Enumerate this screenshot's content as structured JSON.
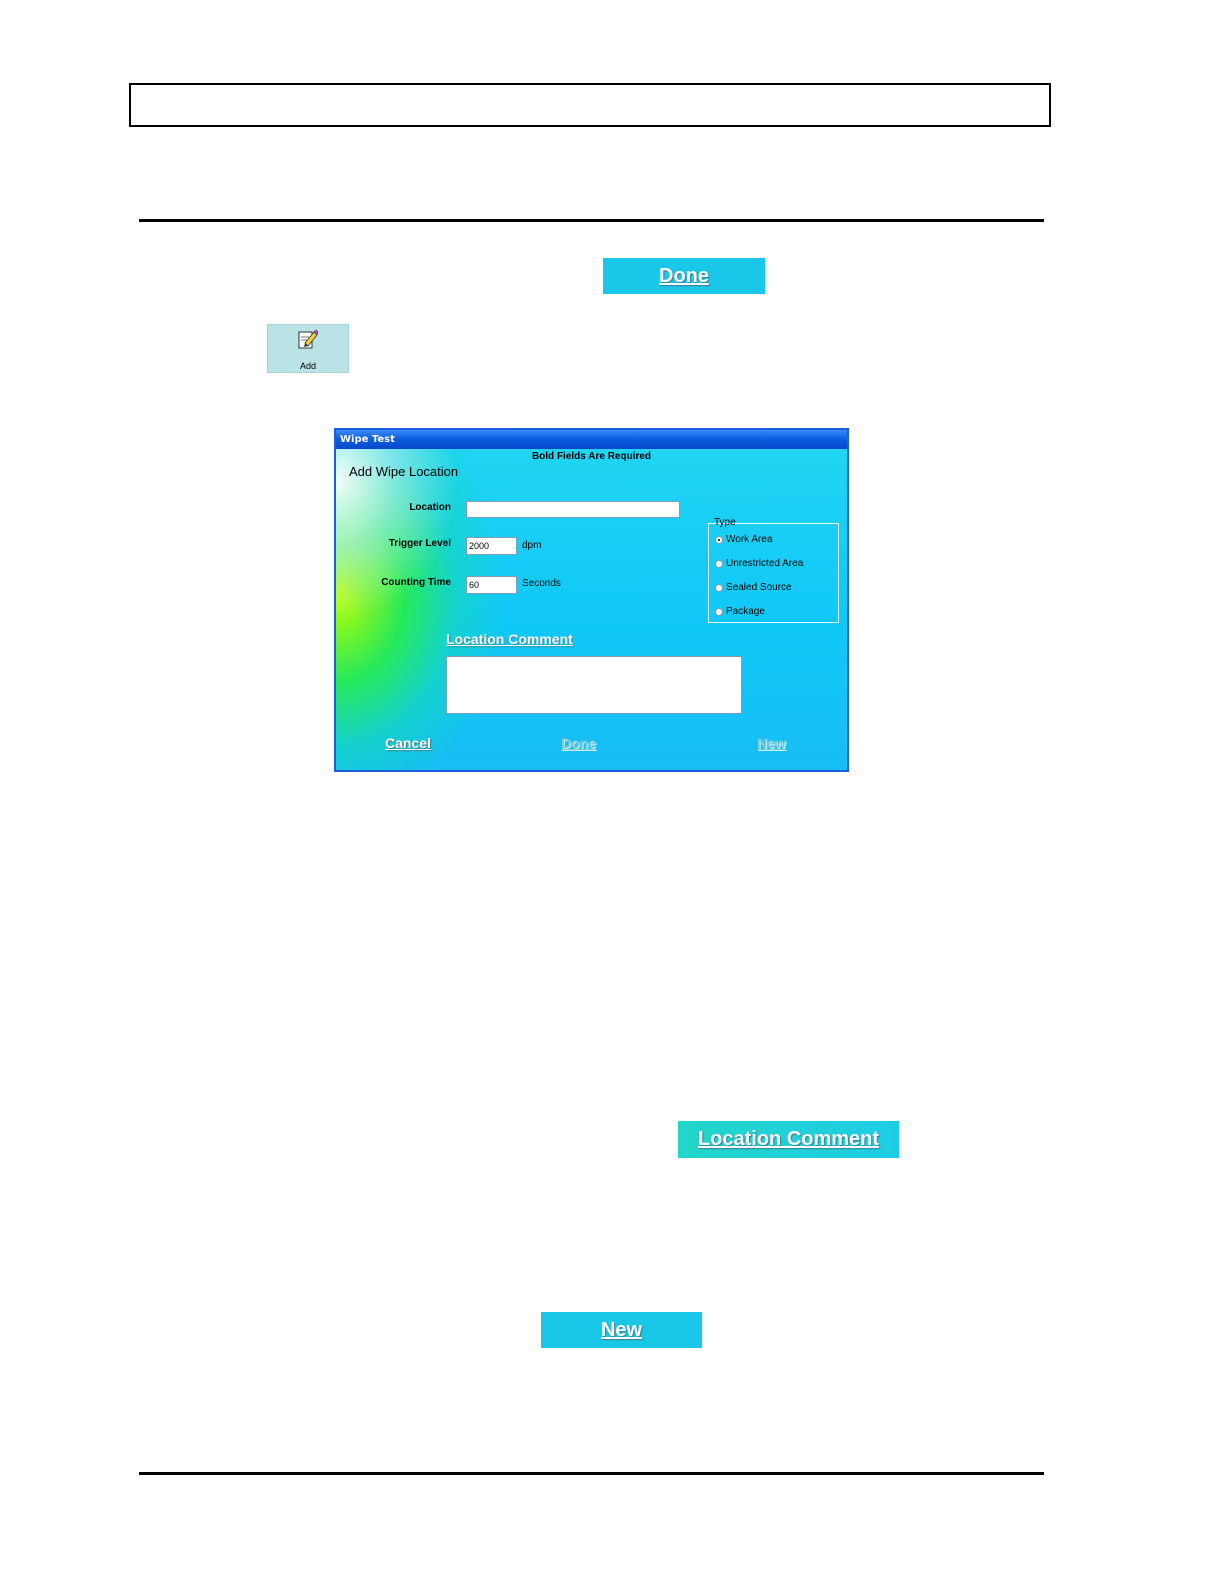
{
  "buttons": {
    "done": "Done",
    "location_comment": "Location Comment",
    "new": "New"
  },
  "add_tool": {
    "label": "Add",
    "icon": "edit-note-icon"
  },
  "dialog": {
    "title": "Wipe Test",
    "required_note": "Bold Fields Are Required",
    "heading": "Add Wipe Location",
    "fields": {
      "location": {
        "label": "Location",
        "value": ""
      },
      "trigger_level": {
        "label": "Trigger Level",
        "value": "2000",
        "unit": "dpm"
      },
      "counting_time": {
        "label": "Counting Time",
        "value": "60",
        "unit": "Seconds"
      }
    },
    "type": {
      "legend": "Type",
      "options": [
        "Work Area",
        "Unrestricted Area",
        "Sealed Source",
        "Package"
      ],
      "selected": "Work Area"
    },
    "comment_label": "Location Comment",
    "comment_value": "",
    "actions": {
      "cancel": "Cancel",
      "done": "Done",
      "new": "New"
    }
  }
}
